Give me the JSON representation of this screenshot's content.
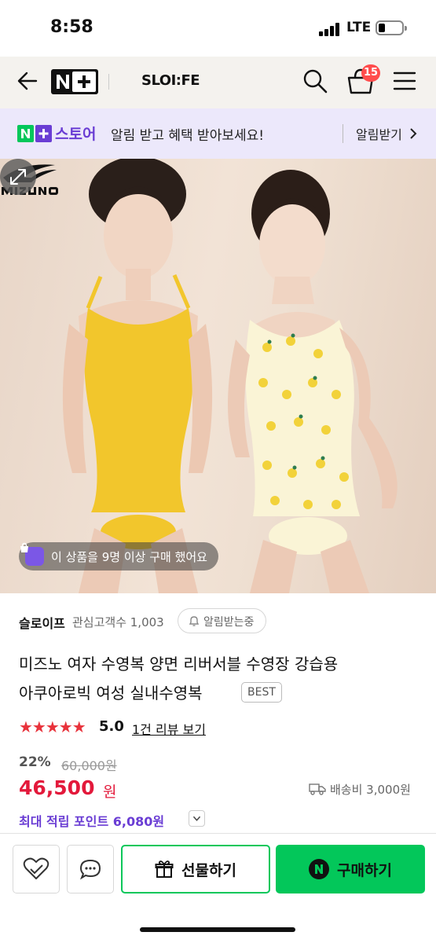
{
  "status_bar": {
    "time": "8:58",
    "network": "LTE"
  },
  "header": {
    "brand": "SLOI:FE",
    "cart_count": "15",
    "icons": [
      "back-arrow-icon",
      "naver-plus-logo",
      "search-icon",
      "cart-icon",
      "menu-icon"
    ]
  },
  "notify_bar": {
    "store_label": "스토어",
    "message": "알림 받고 혜택 받아보세요!",
    "action": "알림받기"
  },
  "hero": {
    "purchase_badge": "이 상품을 9명 이상 구매 했어요"
  },
  "seller": {
    "name": "슬로이프",
    "followers_label": "관심고객수 1,003",
    "alarm_chip": "알림받는중"
  },
  "product": {
    "title_line1": "미즈노 여자 수영복 양면 리버서블 수영장 강습용",
    "title_line2": "아쿠아로빅 여성 실내수영복",
    "badge": "BEST",
    "stars": "★★★★★",
    "rating": "5.0",
    "review_link": "1건 리뷰 보기"
  },
  "price": {
    "discount": "22%",
    "original": "60,000원",
    "sale": "46,500",
    "unit": "원",
    "shipping": "배송비 3,000원",
    "points": "최대 적립 포인트 6,080원"
  },
  "actions": {
    "gift": "선물하기",
    "buy": "구매하기"
  },
  "colors": {
    "naver_green": "#03c75a",
    "store_purple": "#6a3dd4",
    "price_red": "#e3193b",
    "star_red": "#e8323b",
    "badge_red": "#ff4c4c"
  }
}
